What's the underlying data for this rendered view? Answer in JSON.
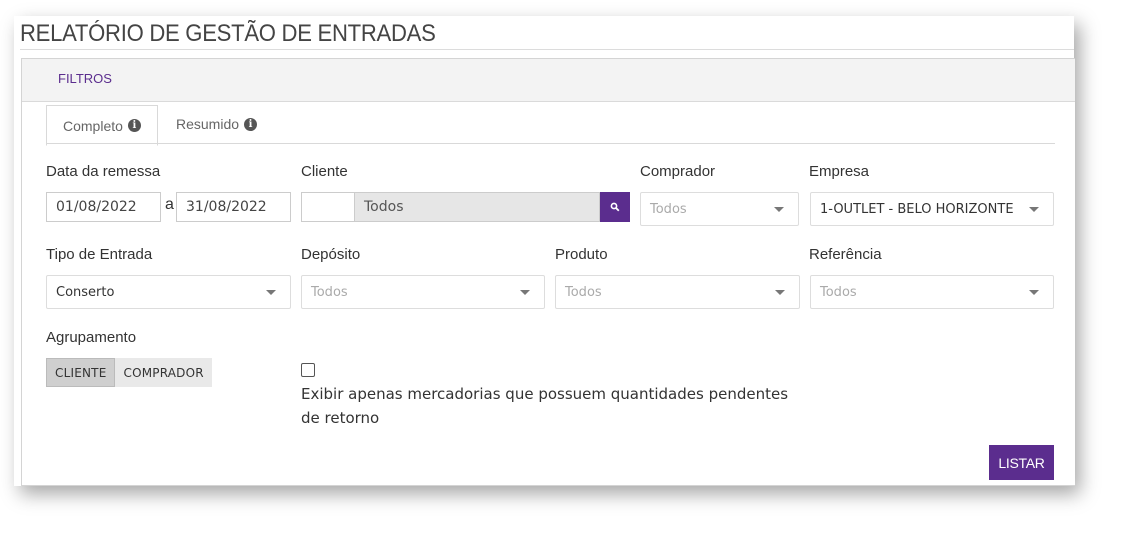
{
  "page": {
    "title": "RELATÓRIO DE GESTÃO DE ENTRADAS"
  },
  "panel": {
    "header": "FILTROS"
  },
  "tabs": [
    {
      "label": "Completo",
      "active": true,
      "icon": "info-circle-icon"
    },
    {
      "label": "Resumido",
      "active": false,
      "icon": "info-circle-icon"
    }
  ],
  "filters": {
    "data_remessa": {
      "label": "Data da remessa",
      "from": "01/08/2022",
      "separator": "a",
      "to": "31/08/2022"
    },
    "cliente": {
      "label": "Cliente",
      "code": "",
      "value": "Todos",
      "search_icon": "search-icon"
    },
    "comprador": {
      "label": "Comprador",
      "value": "Todos"
    },
    "empresa": {
      "label": "Empresa",
      "value": "1-OUTLET - BELO HORIZONTE"
    },
    "tipo_entrada": {
      "label": "Tipo de Entrada",
      "value": "Conserto"
    },
    "deposito": {
      "label": "Depósito",
      "value": "Todos"
    },
    "produto": {
      "label": "Produto",
      "value": "Todos"
    },
    "referencia": {
      "label": "Referência",
      "value": "Todos"
    },
    "agrupamento": {
      "label": "Agrupamento",
      "options": [
        "CLIENTE",
        "COMPRADOR"
      ],
      "selected": "CLIENTE"
    },
    "pendentes": {
      "checked": false,
      "label": "Exibir apenas mercadorias que possuem quantidades pendentes de retorno"
    }
  },
  "actions": {
    "listar": "LISTAR"
  },
  "colors": {
    "accent": "#5b2d8e"
  }
}
